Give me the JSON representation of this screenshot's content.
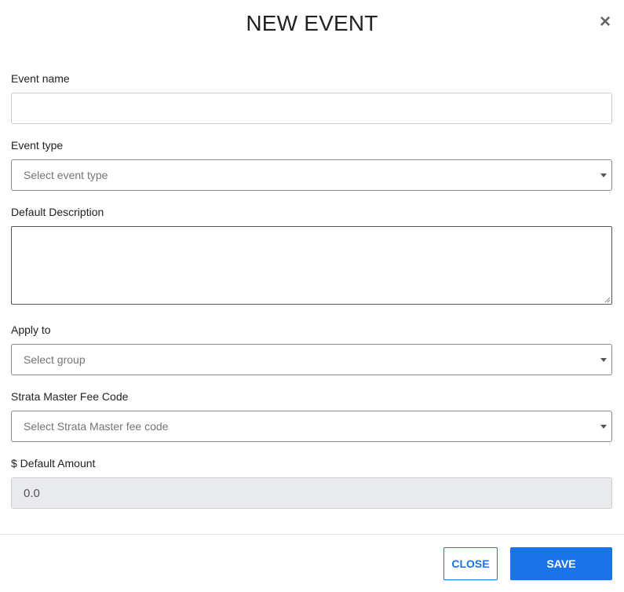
{
  "modal": {
    "title": "NEW EVENT",
    "close_icon": "close-x-icon"
  },
  "form": {
    "event_name": {
      "label": "Event name",
      "value": "",
      "placeholder": ""
    },
    "event_type": {
      "label": "Event type",
      "placeholder": "Select event type"
    },
    "default_description": {
      "label": "Default Description",
      "value": ""
    },
    "apply_to": {
      "label": "Apply to",
      "placeholder": "Select group"
    },
    "fee_code": {
      "label": "Strata Master Fee Code",
      "placeholder": "Select Strata Master fee code"
    },
    "default_amount": {
      "label": "$ Default Amount",
      "value": "0.0"
    }
  },
  "footer": {
    "close_label": "CLOSE",
    "save_label": "SAVE"
  },
  "colors": {
    "primary": "#1a73e8",
    "readonly_bg": "#e8eaed"
  }
}
